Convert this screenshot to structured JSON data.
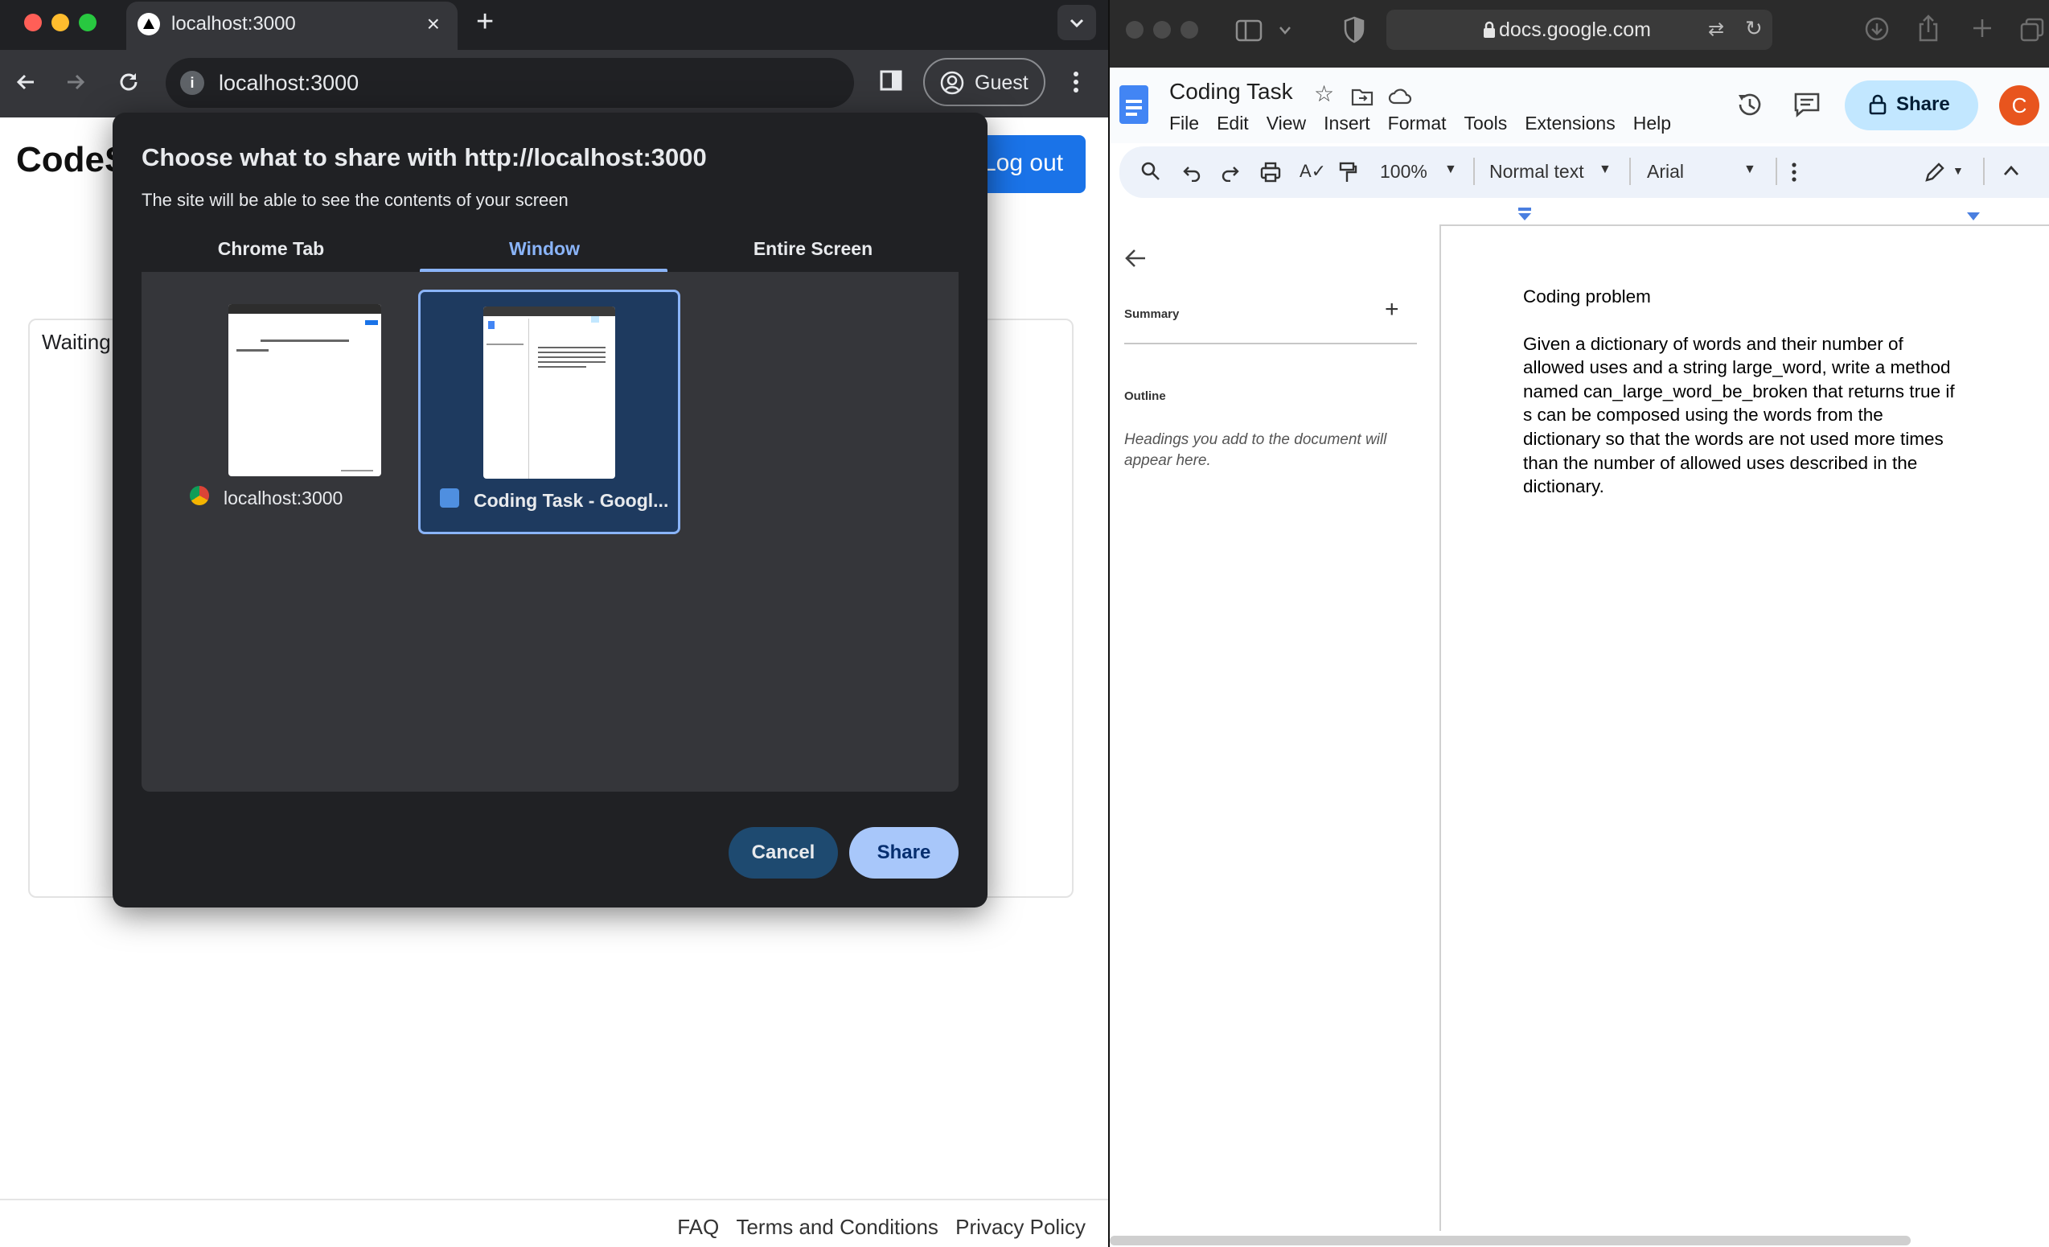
{
  "chrome": {
    "tab_title": "localhost:3000",
    "url": "localhost:3000",
    "profile_label": "Guest",
    "page": {
      "logo_text": "CodeS",
      "logout_label": "Log out",
      "waiting_text": "Waiting",
      "footer_links": [
        "FAQ",
        "Terms and Conditions",
        "Privacy Policy"
      ]
    }
  },
  "share_dialog": {
    "title": "Choose what to share with http://localhost:3000",
    "subtitle": "The site will be able to see the contents of your screen",
    "tabs": [
      "Chrome Tab",
      "Window",
      "Entire Screen"
    ],
    "active_tab": "Window",
    "sources": [
      {
        "label": "localhost:3000",
        "icon": "chrome-icon",
        "selected": false
      },
      {
        "label": "Coding Task - Googl...",
        "icon": "safari-icon",
        "selected": true
      }
    ],
    "cancel_label": "Cancel",
    "share_label": "Share"
  },
  "safari": {
    "url": "docs.google.com"
  },
  "docs": {
    "title": "Coding Task",
    "menu": [
      "File",
      "Edit",
      "View",
      "Insert",
      "Format",
      "Tools",
      "Extensions",
      "Help"
    ],
    "share_label": "Share",
    "avatar_letter": "C",
    "toolbar": {
      "zoom": "100%",
      "style": "Normal text",
      "font": "Arial"
    },
    "side_panel": {
      "summary_label": "Summary",
      "outline_label": "Outline",
      "outline_hint": "Headings you add to the document will appear here."
    },
    "content": {
      "heading": "Coding problem",
      "body_lines": [
        "Given a dictionary of words and their number of",
        "allowed uses and a string large_word, write a method",
        "named can_large_word_be_broken that returns true if",
        "s can be composed using the words from the",
        "dictionary so that the words are not used more times",
        "than the number of allowed uses described in the",
        "dictionary."
      ]
    }
  },
  "colors": {
    "chrome_dark": "#202124",
    "chrome_toolbar": "#35363a",
    "accent_blue": "#8ab4f8",
    "share_button": "#a8c7fa",
    "docs_share": "#c2e7ff",
    "avatar": "#e8551e"
  }
}
